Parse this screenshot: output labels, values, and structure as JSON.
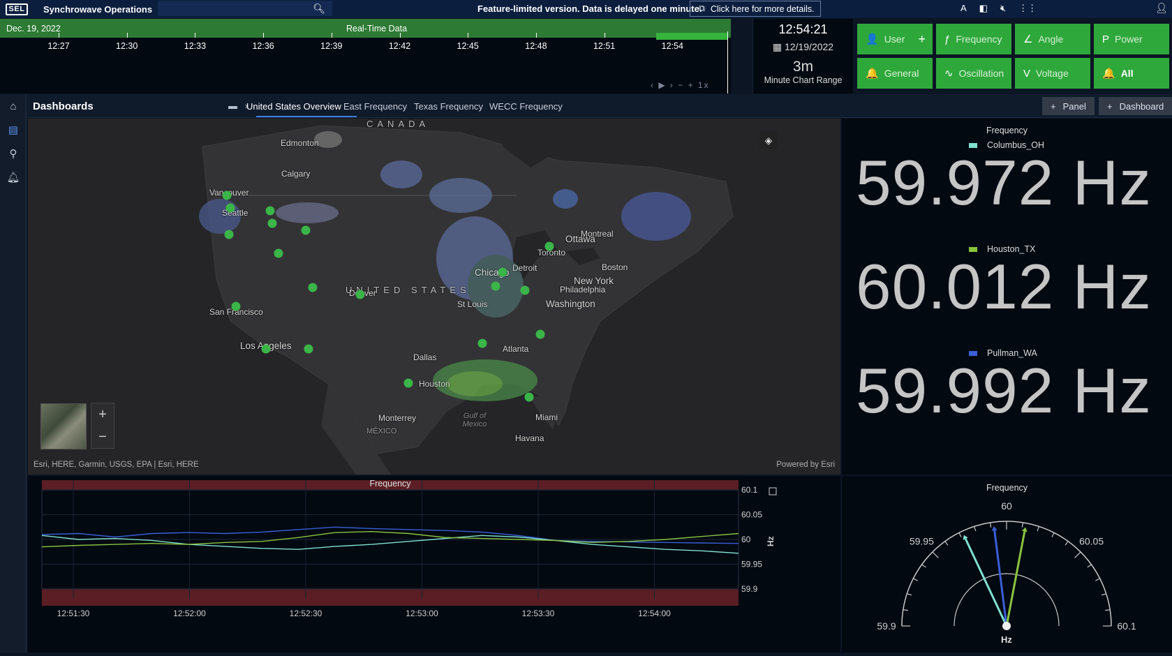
{
  "topbar": {
    "logo": "SEL",
    "app_title": "Synchrowave Operations",
    "search_placeholder": "",
    "notice": "Feature-limited version. Data is delayed one minute.",
    "details_link": "Click here for more details.",
    "icons": [
      "font-size-icon",
      "panel-toggle-icon",
      "mute-icon",
      "grid-menu-icon",
      "user-icon"
    ]
  },
  "timeline": {
    "date": "Dec. 19, 2022",
    "label": "Real-Time Data",
    "times": [
      "12:27",
      "12:30",
      "12:33",
      "12:36",
      "12:39",
      "12:42",
      "12:45",
      "12:48",
      "12:51",
      "12:54"
    ],
    "controls": "‹ ▶ ›  − + 1x",
    "speed": "1x"
  },
  "clock": {
    "time": "12:54:21",
    "date": "12/19/2022",
    "range": "3m",
    "range_label": "Minute Chart Range"
  },
  "filters": [
    {
      "label": "User",
      "icon": "user-icon",
      "glyph": "👤",
      "plus": true
    },
    {
      "label": "Frequency",
      "icon": "frequency-icon",
      "glyph": "ƒ"
    },
    {
      "label": "Angle",
      "icon": "angle-icon",
      "glyph": "∠"
    },
    {
      "label": "Power",
      "icon": "power-icon",
      "glyph": "P"
    },
    {
      "label": "General",
      "icon": "bell-icon",
      "glyph": "🔔"
    },
    {
      "label": "Oscillation",
      "icon": "oscillation-icon",
      "glyph": "∿"
    },
    {
      "label": "Voltage",
      "icon": "voltage-icon",
      "glyph": "V"
    },
    {
      "label": "All",
      "icon": "bell-icon",
      "glyph": "🔔"
    }
  ],
  "dashboard": {
    "title": "Dashboards",
    "tabs": [
      "United States Overview",
      "East Frequency",
      "Texas Frequency",
      "WECC Frequency"
    ],
    "active_tab": "United States Overview",
    "add_panel": "Panel",
    "add_dashboard": "Dashboard"
  },
  "map": {
    "country_labels": [
      "CANADA",
      "UNITED STATES",
      "MÉXICO"
    ],
    "cities": [
      "Edmonton",
      "Calgary",
      "Vancouver",
      "Seattle",
      "San Francisco",
      "Los Angeles",
      "Denver",
      "Dallas",
      "Houston",
      "Monterrey",
      "St Louis",
      "Chicago",
      "Detroit",
      "Toronto",
      "Ottawa",
      "Montreal",
      "Boston",
      "New York",
      "Philadelphia",
      "Washington",
      "Atlanta",
      "Miami",
      "Havana",
      "Gulf of Mexico"
    ],
    "attribution": "Esri, HERE, Garmin, USGS, EPA | Esri, HERE",
    "powered_by": "Powered by Esri"
  },
  "readouts": {
    "title": "Frequency",
    "items": [
      {
        "name": "Columbus_OH",
        "value": "59.972 Hz",
        "color": "#7fe0d0"
      },
      {
        "name": "Houston_TX",
        "value": "60.012 Hz",
        "color": "#8ac43e"
      },
      {
        "name": "Pullman_WA",
        "value": "59.992 Hz",
        "color": "#3a5fd8"
      }
    ]
  },
  "chart_data": [
    {
      "type": "line",
      "title": "Frequency",
      "xlabel": "",
      "ylabel": "Hz",
      "x": [
        "12:51:30",
        "12:52:00",
        "12:52:30",
        "12:53:00",
        "12:53:30",
        "12:54:00"
      ],
      "yticks": [
        "59.9",
        "59.95",
        "60",
        "60.05",
        "60.1"
      ],
      "ylim": [
        59.88,
        60.12
      ],
      "grid": true,
      "series": [
        {
          "name": "Pullman_WA",
          "color": "#3a5fd8",
          "values": [
            60.01,
            60.012,
            60.005,
            60.012,
            60.014,
            60.012,
            60.015,
            60.02,
            60.025,
            60.022,
            60.02,
            60.018,
            60.015,
            60.008,
            59.998,
            59.996,
            59.995,
            59.994,
            59.993,
            59.992
          ]
        },
        {
          "name": "Columbus_OH",
          "color": "#7fe0d0",
          "values": [
            60.008,
            60.0,
            60.002,
            59.998,
            59.99,
            59.986,
            59.982,
            59.98,
            59.986,
            59.99,
            59.996,
            60.002,
            60.008,
            60.005,
            59.998,
            59.99,
            59.985,
            59.98,
            59.977,
            59.972
          ]
        },
        {
          "name": "Houston_TX",
          "color": "#8ac43e",
          "values": [
            59.985,
            59.988,
            59.99,
            59.992,
            59.99,
            59.994,
            59.996,
            60.004,
            60.014,
            60.016,
            60.012,
            60.004,
            60.002,
            60.0,
            59.998,
            59.994,
            59.996,
            60.0,
            60.006,
            60.012
          ]
        }
      ]
    },
    {
      "type": "gauge",
      "title": "Frequency",
      "unit": "Hz",
      "ticks": [
        "59.9",
        "59.95",
        "60",
        "60.05",
        "60.1"
      ],
      "range": [
        59.9,
        60.1
      ],
      "series": [
        {
          "name": "Columbus_OH",
          "value": 59.972,
          "color": "#7fe0d0"
        },
        {
          "name": "Pullman_WA",
          "value": 59.992,
          "color": "#3a5fd8"
        },
        {
          "name": "Houston_TX",
          "value": 60.012,
          "color": "#8ac43e"
        }
      ]
    }
  ]
}
